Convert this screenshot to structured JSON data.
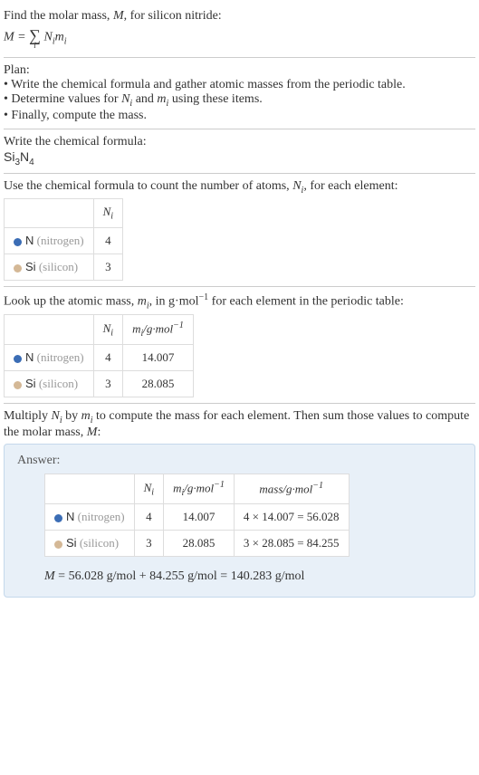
{
  "intro": {
    "line1": "Find the molar mass, ",
    "line1_var": "M",
    "line1_end": ", for silicon nitride:",
    "sum_lhs": "M",
    "sum_eq": " = ",
    "sum_index": "i",
    "sum_body_N": "N",
    "sum_body_m": "m"
  },
  "plan": {
    "header": "Plan:",
    "b1": "• Write the chemical formula and gather atomic masses from the periodic table.",
    "b2_pre": "• Determine values for ",
    "b2_N": "N",
    "b2_i1": "i",
    "b2_mid": " and ",
    "b2_m": "m",
    "b2_i2": "i",
    "b2_post": " using these items.",
    "b3": "• Finally, compute the mass."
  },
  "formula_section": {
    "header": "Write the chemical formula:",
    "si": "Si",
    "si_n": "3",
    "n": "N",
    "n_n": "4"
  },
  "count_section": {
    "header_pre": "Use the chemical formula to count the number of atoms, ",
    "header_var": "N",
    "header_sub": "i",
    "header_post": ", for each element:",
    "col_N": "N",
    "col_N_sub": "i",
    "rows": [
      {
        "sym": "N",
        "name": "(nitrogen)",
        "dot": "dot-n",
        "n": "4"
      },
      {
        "sym": "Si",
        "name": "(silicon)",
        "dot": "dot-si",
        "n": "3"
      }
    ]
  },
  "mass_section": {
    "header_pre": "Look up the atomic mass, ",
    "header_m": "m",
    "header_sub": "i",
    "header_mid": ", in g·mol",
    "header_exp": "−1",
    "header_post": " for each element in the periodic table:",
    "col_N": "N",
    "col_N_sub": "i",
    "col_m": "m",
    "col_m_sub": "i",
    "col_m_unit": "/g·mol",
    "col_m_exp": "−1",
    "rows": [
      {
        "sym": "N",
        "name": "(nitrogen)",
        "dot": "dot-n",
        "n": "4",
        "m": "14.007"
      },
      {
        "sym": "Si",
        "name": "(silicon)",
        "dot": "dot-si",
        "n": "3",
        "m": "28.085"
      }
    ]
  },
  "mult_section": {
    "line_pre": "Multiply ",
    "N": "N",
    "Ni": "i",
    "mid": " by ",
    "m": "m",
    "mi": "i",
    "line_post1": " to compute the mass for each element. Then sum those values to compute the molar mass, ",
    "Mvar": "M",
    "line_post2": ":"
  },
  "answer": {
    "title": "Answer:",
    "col_N": "N",
    "col_N_sub": "i",
    "col_m": "m",
    "col_m_sub": "i",
    "col_m_unit": "/g·mol",
    "col_m_exp": "−1",
    "col_mass": "mass/g·mol",
    "col_mass_exp": "−1",
    "rows": [
      {
        "sym": "N",
        "name": "(nitrogen)",
        "dot": "dot-n",
        "n": "4",
        "m": "14.007",
        "calc": "4 × 14.007 = 56.028"
      },
      {
        "sym": "Si",
        "name": "(silicon)",
        "dot": "dot-si",
        "n": "3",
        "m": "28.085",
        "calc": "3 × 28.085 = 84.255"
      }
    ],
    "final_M": "M",
    "final_eq": " = 56.028 g/mol + 84.255 g/mol = 140.283 g/mol"
  },
  "chart_data": {
    "type": "table",
    "title": "Molar mass computation for silicon nitride (Si3N4)",
    "elements": [
      {
        "element": "N (nitrogen)",
        "N_i": 4,
        "m_i_g_per_mol": 14.007,
        "mass_g_per_mol": 56.028
      },
      {
        "element": "Si (silicon)",
        "N_i": 3,
        "m_i_g_per_mol": 28.085,
        "mass_g_per_mol": 84.255
      }
    ],
    "molar_mass_g_per_mol": 140.283
  }
}
